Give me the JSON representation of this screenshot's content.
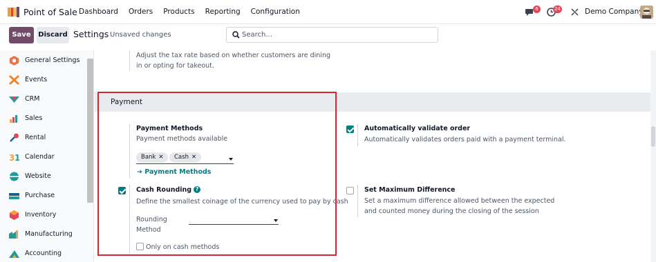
{
  "navbar": {
    "app_name": "Point of Sale",
    "menu": [
      "Dashboard",
      "Orders",
      "Products",
      "Reporting",
      "Configuration"
    ],
    "chat_badge": "6",
    "activity_badge": "24",
    "company": "Demo Company",
    "accent_color": "#714b67",
    "badge_color": "#e0475a"
  },
  "control_panel": {
    "save_label": "Save",
    "discard_label": "Discard",
    "title": "Settings",
    "status": "Unsaved changes",
    "search_placeholder": "Search..."
  },
  "sidebar": {
    "items": [
      {
        "label": "General Settings",
        "icon": "general-settings-icon"
      },
      {
        "label": "Events",
        "icon": "events-icon"
      },
      {
        "label": "CRM",
        "icon": "crm-icon"
      },
      {
        "label": "Sales",
        "icon": "sales-icon"
      },
      {
        "label": "Rental",
        "icon": "rental-icon"
      },
      {
        "label": "Calendar",
        "icon": "calendar-icon"
      },
      {
        "label": "Website",
        "icon": "website-icon"
      },
      {
        "label": "Purchase",
        "icon": "purchase-icon"
      },
      {
        "label": "Inventory",
        "icon": "inventory-icon"
      },
      {
        "label": "Manufacturing",
        "icon": "manufacturing-icon"
      },
      {
        "label": "Accounting",
        "icon": "accounting-icon"
      }
    ]
  },
  "content": {
    "top_desc": "Adjust the tax rate based on whether customers are dining in or opting for takeout.",
    "section_title": "Payment",
    "payment_methods": {
      "title": "Payment Methods",
      "desc": "Payment methods available",
      "tags": [
        "Bank",
        "Cash"
      ],
      "link": "Payment Methods"
    },
    "auto_validate": {
      "title": "Automatically validate order",
      "desc": "Automatically validates orders paid with a payment terminal.",
      "checked": true
    },
    "cash_rounding": {
      "title": "Cash Rounding",
      "help": "?",
      "desc": "Define the smallest coinage of the currency used to pay by cash",
      "checked": true,
      "rounding_label_line1": "Rounding",
      "rounding_label_line2": "Method",
      "rounding_value": "",
      "only_cash_label": "Only on cash methods",
      "only_cash_checked": false
    },
    "max_difference": {
      "title": "Set Maximum Difference",
      "desc": "Set a maximum difference allowed between the expected and counted money during the closing of the session",
      "checked": false
    },
    "check_color": "#017e84",
    "highlight_color": "#d6252f"
  }
}
